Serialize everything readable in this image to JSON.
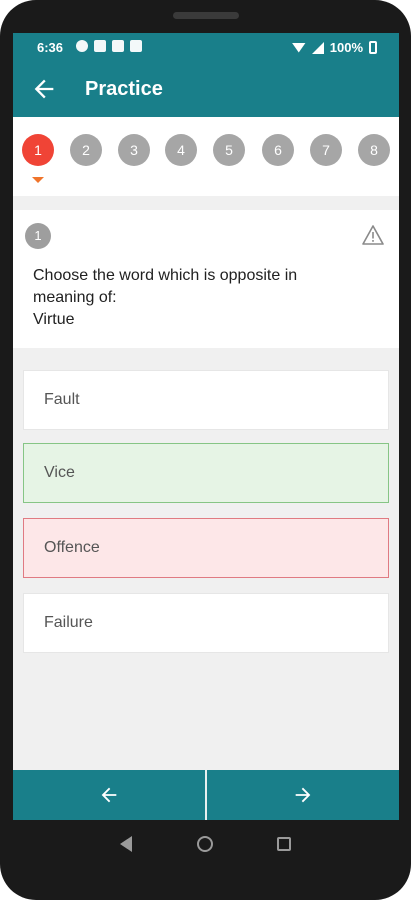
{
  "status_bar": {
    "time": "6:36",
    "battery": "100%"
  },
  "app_bar": {
    "title": "Practice",
    "back_icon": "arrow-left-icon"
  },
  "question_nav": {
    "items": [
      "1",
      "2",
      "3",
      "4",
      "5",
      "6",
      "7",
      "8"
    ],
    "active_index": 0
  },
  "question": {
    "number": "1",
    "text": "Choose the word which is opposite in\nmeaning of:\nVirtue",
    "report_icon": "warning-icon"
  },
  "options": [
    {
      "label": "Fault",
      "state": "normal"
    },
    {
      "label": "Vice",
      "state": "correct"
    },
    {
      "label": "Offence",
      "state": "wrong"
    },
    {
      "label": "Failure",
      "state": "normal"
    }
  ],
  "bottom_nav": {
    "prev_icon": "arrow-left-icon",
    "next_icon": "arrow-right-icon"
  },
  "colors": {
    "primary": "#197f8a",
    "active_bubble": "#f04436",
    "correct_bg": "#e6f4e5",
    "wrong_bg": "#fde7e8"
  }
}
